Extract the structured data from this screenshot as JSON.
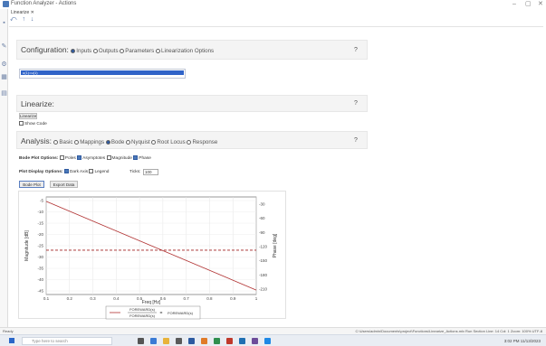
{
  "window": {
    "title": "Function Analyzer - Actions",
    "controls": [
      "–",
      "▢",
      "✕"
    ]
  },
  "tab": {
    "label": "Linearize ✕"
  },
  "mini_tools": [
    "⤺",
    "↑",
    "↓"
  ],
  "configuration": {
    "header": "Configuration:",
    "options": [
      "Inputs",
      "Outputs",
      "Parameters",
      "Linearization Options"
    ],
    "selected": "Inputs",
    "list_item": "u(1)=u(1)",
    "help": "?"
  },
  "linearize": {
    "header": "Linearize:",
    "button": "Linearize",
    "checkbox_label": "Show Code",
    "help": "?"
  },
  "analysis": {
    "header": "Analysis:",
    "options": [
      "Basic",
      "Mappings",
      "Bode",
      "Nyquist",
      "Root Locus",
      "Response"
    ],
    "selected": "Bode",
    "help": "?"
  },
  "bode_plot_options": {
    "label": "Bode Plot Options:",
    "items": [
      {
        "label": "Poles",
        "checked": false
      },
      {
        "label": "Asymptotes",
        "checked": true
      },
      {
        "label": "Magnitude",
        "checked": false
      },
      {
        "label": "Phase",
        "checked": true
      }
    ]
  },
  "plot_display_options": {
    "label": "Plot Display Options:",
    "items": [
      {
        "label": "Dark Axis",
        "checked": true
      },
      {
        "label": "Legend",
        "checked": false
      }
    ],
    "ticks_label": "Ticks:",
    "ticks_value": "100"
  },
  "buttons": {
    "bode_plot": "Bode Plot",
    "export_data": "Export Data"
  },
  "chart_data": {
    "type": "line",
    "x": [
      0.1,
      1
    ],
    "x_ticks": [
      "0.1",
      "0.2",
      "0.3",
      "0.4",
      "0.5",
      "0.6",
      "0.7",
      "0.8",
      "0.9",
      "1"
    ],
    "xlabel": "Freq [Hz]",
    "left_ylabel": "Magnitude [dB]",
    "right_ylabel": "Phase [deg]",
    "left_y_ticks": [
      "-5",
      "-10",
      "-15",
      "-20",
      "-25",
      "-30",
      "-35",
      "-40",
      "-45"
    ],
    "right_y_ticks": [
      "-30",
      "-60",
      "-90",
      "-120",
      "-150",
      "-180",
      "-210"
    ],
    "series": [
      {
        "values": [
          -5,
          -45
        ],
        "color": "#b03030",
        "style": "solid"
      },
      {
        "values": [
          -27,
          -27
        ],
        "color": "#a02020",
        "style": "dashed"
      }
    ],
    "legend_lines": [
      "FOREWARD(s)",
      "FOREWARD(s)"
    ],
    "legend_equals": "=",
    "legend_rhs": "FOREWARD(s)"
  },
  "status": {
    "left": "Ready",
    "right": "C:\\Users\\admin\\Documents\\project\\Functions\\Linearize_Actions.mlx   Run Section   Line: 14   Col: 1   Zoom: 100%   UTF-8"
  },
  "taskbar": {
    "search_placeholder": "Type here to search",
    "time": "3:02 PM",
    "date": "11/13/2023"
  }
}
